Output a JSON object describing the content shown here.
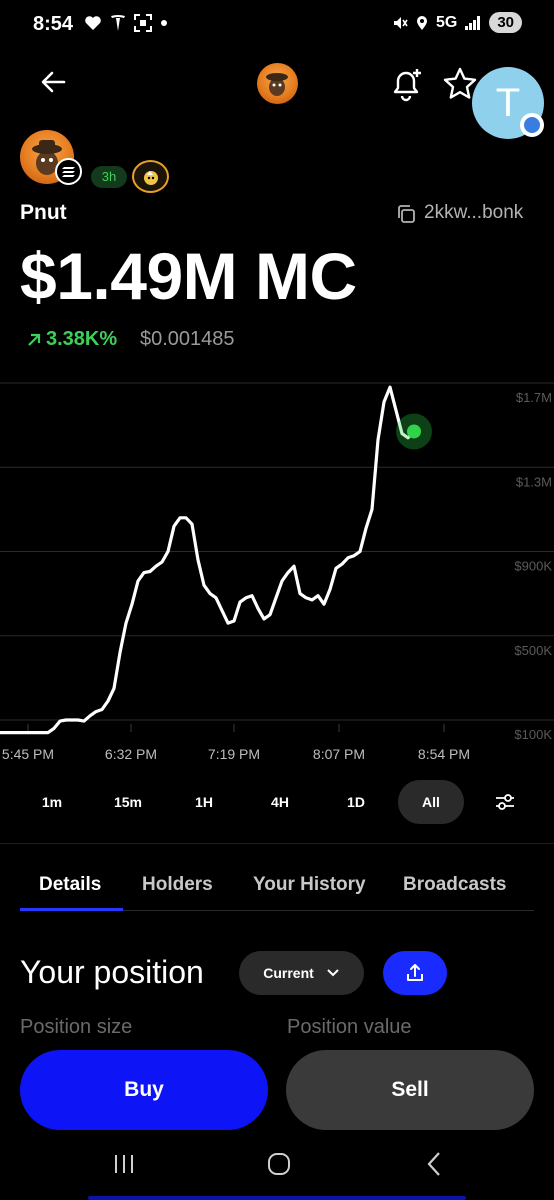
{
  "status_bar": {
    "time": "8:54",
    "network": "5G",
    "battery": "30",
    "icons": [
      "heart-icon",
      "tesla-icon",
      "scan-icon",
      "dot-icon",
      "mute-icon",
      "location-icon",
      "signal-icon"
    ]
  },
  "header": {
    "back_icon": "arrow-left-icon",
    "token_icon": "pnut-token-icon",
    "alert_icon": "bell-plus-icon",
    "watchlist_icon": "star-icon",
    "avatar_letter": "T"
  },
  "token": {
    "name": "Pnut",
    "age": "3h",
    "address": "2kkw...bonk",
    "market_cap": "$1.49M MC",
    "change": "3.38K%",
    "price": "$0.001485",
    "change_color": "#3fce5a"
  },
  "chart_data": {
    "type": "line",
    "y_tick_labels": [
      "$1.7M",
      "$1.3M",
      "$900K",
      "$500K",
      "$100K"
    ],
    "y_ticks": [
      1700000,
      1300000,
      900000,
      500000,
      100000
    ],
    "x_tick_labels": [
      "5:45 PM",
      "6:32 PM",
      "7:19 PM",
      "8:07 PM",
      "8:54 PM"
    ],
    "ylim": [
      100000,
      1700000
    ],
    "series": [
      {
        "color": "#ffffff",
        "values": [
          40000,
          40000,
          40000,
          40000,
          40000,
          40000,
          40000,
          40000,
          40000,
          60000,
          95000,
          100000,
          100000,
          100000,
          95000,
          120000,
          140000,
          150000,
          190000,
          250000,
          420000,
          560000,
          650000,
          760000,
          800000,
          805000,
          830000,
          850000,
          900000,
          1020000,
          1060000,
          1060000,
          1030000,
          860000,
          740000,
          700000,
          680000,
          620000,
          560000,
          570000,
          660000,
          680000,
          690000,
          630000,
          580000,
          600000,
          680000,
          760000,
          800000,
          830000,
          700000,
          680000,
          670000,
          690000,
          650000,
          720000,
          820000,
          840000,
          870000,
          880000,
          900000,
          1010000,
          1100000,
          1430000,
          1610000,
          1680000,
          1570000,
          1460000,
          1440000,
          1470000
        ]
      }
    ],
    "current_point_color": "#2fd44a",
    "grid": true
  },
  "timeframes": {
    "items": [
      "1m",
      "15m",
      "1H",
      "4H",
      "1D",
      "All"
    ],
    "active": "All",
    "settings_icon": "sliders-icon"
  },
  "tabs": {
    "items": [
      "Details",
      "Holders",
      "Your History",
      "Broadcasts"
    ],
    "active": "Details"
  },
  "position": {
    "title": "Your position",
    "filter": "Current",
    "share_icon": "share-icon",
    "size_label": "Position size",
    "value_label": "Position value"
  },
  "actions": {
    "buy": "Buy",
    "sell": "Sell"
  },
  "nav": {
    "recents_icon": "recents-icon",
    "home_icon": "home-icon",
    "back_icon": "back-icon"
  }
}
